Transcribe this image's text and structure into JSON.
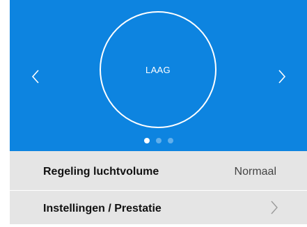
{
  "carousel": {
    "level_label": "LAAG",
    "background_color": "#0d84e0",
    "prev_icon": "chevron-left-icon",
    "next_icon": "chevron-right-icon",
    "page_count": 3,
    "active_page": 1
  },
  "settings": {
    "rows": [
      {
        "label": "Regeling luchtvolume",
        "value": "Normaal"
      },
      {
        "label": "Instellingen / Prestatie",
        "icon": "chevron-right-icon"
      }
    ]
  }
}
